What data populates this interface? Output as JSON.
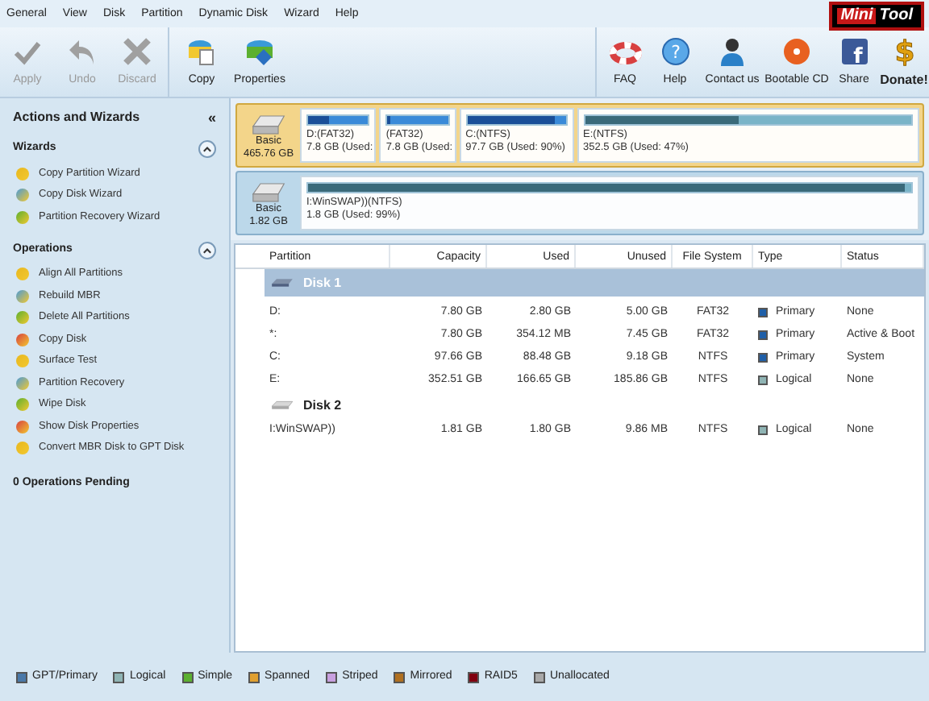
{
  "menu": [
    "General",
    "View",
    "Disk",
    "Partition",
    "Dynamic Disk",
    "Wizard",
    "Help"
  ],
  "logo": {
    "part_1": "Mini",
    "part_2": "Tool"
  },
  "toolbar_left": [
    {
      "label": "Apply",
      "kind": "check",
      "disabled": true
    },
    {
      "label": "Undo",
      "kind": "undo",
      "disabled": true
    },
    {
      "label": "Discard",
      "kind": "cross",
      "disabled": true
    }
  ],
  "toolbar_mid": [
    {
      "label": "Copy",
      "kind": "copy",
      "disabled": false
    },
    {
      "label": "Properties",
      "kind": "props",
      "disabled": false
    }
  ],
  "toolbar_right": [
    {
      "label": "FAQ",
      "kind": "lifebuoy"
    },
    {
      "label": "Help",
      "kind": "help",
      "glyph": "?"
    },
    {
      "label": "Contact us",
      "kind": "person"
    },
    {
      "label": "Bootable CD",
      "kind": "cd"
    },
    {
      "label": "Share",
      "kind": "share",
      "glyph": "f"
    },
    {
      "label": "Donate!",
      "kind": "dollar",
      "glyph": "$"
    }
  ],
  "sidebar": {
    "title": "Actions and Wizards",
    "collapse_glyph": "«",
    "sections": [
      {
        "title": "Wizards",
        "expanded": true,
        "items": [
          "Copy Partition Wizard",
          "Copy Disk Wizard",
          "Partition Recovery Wizard"
        ]
      },
      {
        "title": "Operations",
        "expanded": true,
        "items": [
          "Align All Partitions",
          "Rebuild MBR",
          "Delete All Partitions",
          "Copy Disk",
          "Surface Test",
          "Partition Recovery",
          "Wipe Disk",
          "Show Disk Properties",
          "Convert MBR Disk to GPT Disk"
        ]
      }
    ],
    "pending": "0 Operations Pending"
  },
  "disk_map": [
    {
      "type": "Basic",
      "size": "465.76 GB",
      "selected": true,
      "partitions": [
        {
          "label": "D:(FAT32)",
          "detail": "7.8 GB (Used:",
          "level": 0.36
        },
        {
          "label": "(FAT32)",
          "detail": "7.8 GB (Used:",
          "level": 0.05
        },
        {
          "label": "C:(NTFS)",
          "detail": "97.7 GB (Used: 90%)",
          "level": 0.9
        },
        {
          "label": "E:(NTFS)",
          "detail": "352.5 GB (Used: 47%)",
          "level": 0.47
        }
      ]
    },
    {
      "type": "Basic",
      "size": "1.82 GB",
      "selected": false,
      "partitions": [
        {
          "label": "I:WinSWAP))(NTFS)",
          "detail": "1.8 GB (Used: 99%)",
          "level": 0.99
        }
      ]
    }
  ],
  "table": {
    "columns": [
      "Partition",
      "Capacity",
      "Used",
      "Unused",
      "File System",
      "Type",
      "Status"
    ],
    "disks": [
      {
        "name": "Disk 1",
        "selected": true,
        "rows": [
          {
            "cells": [
              "D:",
              "7.80 GB",
              "2.80 GB",
              "5.00 GB",
              "FAT32",
              "Primary",
              "None"
            ],
            "color": "#1f5fa8"
          },
          {
            "cells": [
              "*:",
              "7.80 GB",
              "354.12 MB",
              "7.45 GB",
              "FAT32",
              "Primary",
              "Active & Boot"
            ],
            "color": "#1f5fa8"
          },
          {
            "cells": [
              "C:",
              "97.66 GB",
              "88.48 GB",
              "9.18 GB",
              "NTFS",
              "Primary",
              "System"
            ],
            "color": "#1f5fa8"
          },
          {
            "cells": [
              "E:",
              "352.51 GB",
              "166.65 GB",
              "185.86 GB",
              "NTFS",
              "Logical",
              "None"
            ],
            "color": "#8fb4b4"
          }
        ]
      },
      {
        "name": "Disk 2",
        "selected": false,
        "rows": [
          {
            "cells": [
              "I:WinSWAP))",
              "1.81 GB",
              "1.80 GB",
              "9.86 MB",
              "NTFS",
              "Logical",
              "None"
            ],
            "color": "#8fb4b4"
          }
        ]
      }
    ]
  },
  "legend": [
    {
      "label": "GPT/Primary",
      "color": "#4a78a8"
    },
    {
      "label": "Logical",
      "color": "#8fb4b4"
    },
    {
      "label": "Simple",
      "color": "#5cb030"
    },
    {
      "label": "Spanned",
      "color": "#e0a030"
    },
    {
      "label": "Striped",
      "color": "#c8a0e0"
    },
    {
      "label": "Mirrored",
      "color": "#b07020"
    },
    {
      "label": "RAID5",
      "color": "#800010"
    },
    {
      "label": "Unallocated",
      "color": "#a8a8a8"
    }
  ]
}
